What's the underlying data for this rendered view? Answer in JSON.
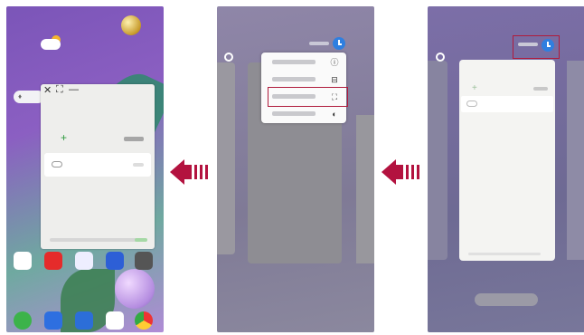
{
  "colors": {
    "accent_red": "#b3123f",
    "clock_blue": "#2f7fe0",
    "card_bg": "#eeeeec"
  },
  "panel1": {
    "popup_controls": {
      "close": "✕",
      "resize": "⛶",
      "minimize": "—"
    },
    "add_symbol": "+",
    "icons": [
      "weather-icon",
      "gallery-icon",
      "youtube-icon",
      "settings-icon",
      "phone-icon",
      "messages-icon",
      "camera-icon",
      "play-store-icon",
      "chrome-icon"
    ]
  },
  "panel2": {
    "menu_items": [
      {
        "icon": "app-info-icon",
        "glyph": "ⓘ"
      },
      {
        "icon": "split-view-icon",
        "glyph": "⊟"
      },
      {
        "icon": "popup-view-icon",
        "glyph": "⛶",
        "highlighted": true
      },
      {
        "icon": "pin-icon",
        "glyph": "◐"
      }
    ]
  },
  "panel3": {
    "add_symbol": "+",
    "highlighted_icon": "clock-icon"
  }
}
